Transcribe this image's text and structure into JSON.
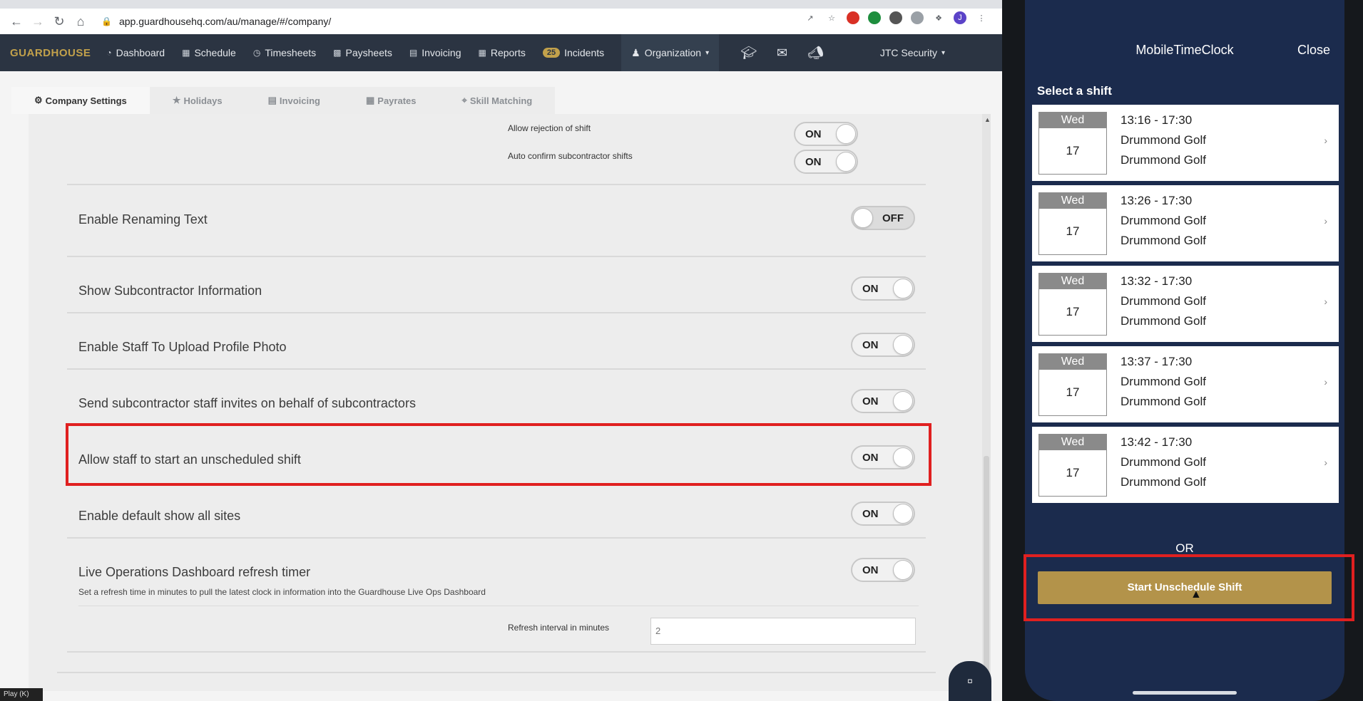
{
  "browser": {
    "url": "app.guardhousehq.com/au/manage/#/company/"
  },
  "app": {
    "logo": "GUARDHOUSE",
    "nav": [
      {
        "label": "Dashboard"
      },
      {
        "label": "Schedule"
      },
      {
        "label": "Timesheets"
      },
      {
        "label": "Paysheets"
      },
      {
        "label": "Invoicing"
      },
      {
        "label": "Reports"
      },
      {
        "label": "Incidents",
        "badge": "25"
      },
      {
        "label": "Organization"
      }
    ],
    "company": "JTC Security"
  },
  "tabs": [
    {
      "label": "Company Settings",
      "active": true
    },
    {
      "label": "Holidays"
    },
    {
      "label": "Invoicing"
    },
    {
      "label": "Payrates"
    },
    {
      "label": "Skill Matching"
    }
  ],
  "sub_settings": {
    "allow_rejection": {
      "label": "Allow rejection of shift",
      "state": "ON"
    },
    "auto_confirm": {
      "label": "Auto confirm subcontractor shifts",
      "state": "ON"
    }
  },
  "settings": [
    {
      "label": "Enable Renaming Text",
      "state": "OFF"
    },
    {
      "label": "Show Subcontractor Information",
      "state": "ON"
    },
    {
      "label": "Enable Staff To Upload Profile Photo",
      "state": "ON"
    },
    {
      "label": "Send subcontractor staff invites on behalf of subcontractors",
      "state": "ON"
    },
    {
      "label": "Allow staff to start an unscheduled shift",
      "state": "ON"
    },
    {
      "label": "Enable default show all sites",
      "state": "ON"
    },
    {
      "label": "Live Operations Dashboard refresh timer",
      "state": "ON",
      "description": "Set a refresh time in minutes to pull the latest clock in information into the Guardhouse Live Ops Dashboard"
    }
  ],
  "refresh": {
    "label": "Refresh interval in minutes",
    "value": "2"
  },
  "play_tip": "Play (K)",
  "phone": {
    "title": "MobileTimeClock",
    "close": "Close",
    "subtitle": "Select a shift",
    "shifts": [
      {
        "dow": "Wed",
        "dom": "17",
        "time": "13:16 - 17:30",
        "site": "Drummond Golf",
        "site2": "Drummond Golf"
      },
      {
        "dow": "Wed",
        "dom": "17",
        "time": "13:26 - 17:30",
        "site": "Drummond Golf",
        "site2": "Drummond Golf"
      },
      {
        "dow": "Wed",
        "dom": "17",
        "time": "13:32 - 17:30",
        "site": "Drummond Golf",
        "site2": "Drummond Golf"
      },
      {
        "dow": "Wed",
        "dom": "17",
        "time": "13:37 - 17:30",
        "site": "Drummond Golf",
        "site2": "Drummond Golf"
      },
      {
        "dow": "Wed",
        "dom": "17",
        "time": "13:42 - 17:30",
        "site": "Drummond Golf",
        "site2": "Drummond Golf"
      }
    ],
    "or": "OR",
    "start_button": "Start Unschedule Shift"
  },
  "colors": {
    "appbar": "#2b3442",
    "accent": "#c2a14b",
    "highlight": "#e02020",
    "phone_bg": "#1b2b4d",
    "start_button": "#b3934a"
  }
}
